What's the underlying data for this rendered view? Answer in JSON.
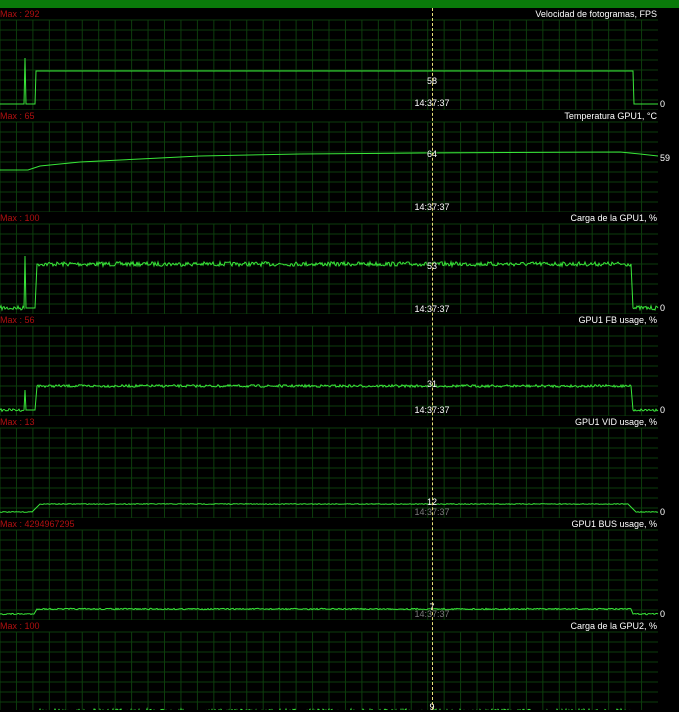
{
  "cursor_time": "14:37:37",
  "panels": [
    {
      "max_label": "Max : 292",
      "title": "Velocidad de fotogramas, FPS",
      "current": "58",
      "end": "0",
      "time": "14:37:37",
      "time_dim": false,
      "trace": [
        [
          0,
          96
        ],
        [
          24,
          96
        ],
        [
          25,
          50
        ],
        [
          26,
          96
        ],
        [
          35,
          96
        ],
        [
          36,
          63
        ],
        [
          420,
          63
        ],
        [
          633,
          63
        ],
        [
          634,
          96
        ],
        [
          658,
          96
        ]
      ]
    },
    {
      "max_label": "Max : 65",
      "title": "Temperatura GPU1, °C",
      "current": "64",
      "end": "59",
      "time": "14:37:37",
      "time_dim": false,
      "trace": [
        [
          0,
          60
        ],
        [
          28,
          60
        ],
        [
          40,
          56
        ],
        [
          80,
          52
        ],
        [
          140,
          49
        ],
        [
          200,
          46
        ],
        [
          300,
          44
        ],
        [
          420,
          43
        ],
        [
          620,
          42
        ],
        [
          640,
          44
        ],
        [
          658,
          46
        ]
      ]
    },
    {
      "max_label": "Max : 100",
      "title": "Carga de la GPU1, %",
      "current": "53",
      "end": "0",
      "time": "14:37:37",
      "time_dim": false,
      "trace": [
        [
          0,
          96
        ],
        [
          24,
          96
        ],
        [
          25,
          44
        ],
        [
          26,
          96
        ],
        [
          35,
          96
        ],
        [
          37,
          52
        ],
        [
          420,
          52
        ],
        [
          631,
          52
        ],
        [
          633,
          96
        ],
        [
          658,
          96
        ]
      ],
      "noise": 2.2
    },
    {
      "max_label": "Max : 56",
      "title": "GPU1 FB usage, %",
      "current": "31",
      "end": "0",
      "time": "14:37:37",
      "time_dim": false,
      "trace": [
        [
          0,
          96
        ],
        [
          24,
          96
        ],
        [
          25,
          76
        ],
        [
          26,
          96
        ],
        [
          35,
          96
        ],
        [
          37,
          72
        ],
        [
          420,
          72
        ],
        [
          631,
          72
        ],
        [
          633,
          96
        ],
        [
          658,
          96
        ]
      ],
      "noise": 1.3
    },
    {
      "max_label": "Max : 13",
      "title": "GPU1 VID usage, %",
      "current": "12",
      "end": "0",
      "time": "14:37:37",
      "time_dim": true,
      "trace": [
        [
          0,
          96
        ],
        [
          32,
          96
        ],
        [
          40,
          88
        ],
        [
          420,
          88
        ],
        [
          628,
          88
        ],
        [
          636,
          96
        ],
        [
          658,
          96
        ]
      ],
      "noise": 0.4
    },
    {
      "max_label": "Max : 4294967295",
      "title": "GPU1 BUS usage, %",
      "current": "7",
      "end": "0",
      "time": "14:37:37",
      "time_dim": true,
      "trace": [
        [
          0,
          96
        ],
        [
          34,
          96
        ],
        [
          37,
          91
        ],
        [
          420,
          91
        ],
        [
          631,
          91
        ],
        [
          633,
          96
        ],
        [
          658,
          96
        ]
      ],
      "noise": 0.7
    },
    {
      "max_label": "Max : 100",
      "title": "Carga de la GPU2, %",
      "current": "9",
      "end": "",
      "time": "",
      "time_dim": false,
      "trace": [
        [
          0,
          100
        ],
        [
          35,
          100
        ],
        [
          36,
          92
        ],
        [
          420,
          92
        ],
        [
          632,
          92
        ],
        [
          634,
          100
        ],
        [
          658,
          100
        ]
      ],
      "noise": 3.0
    }
  ],
  "colors": {
    "background": "#000000",
    "grid": "#0d3d0d",
    "trace": "#39e639",
    "max_label": "#b01010",
    "cursor": "#e8e07a",
    "top_bar": "#0a7a0a"
  }
}
